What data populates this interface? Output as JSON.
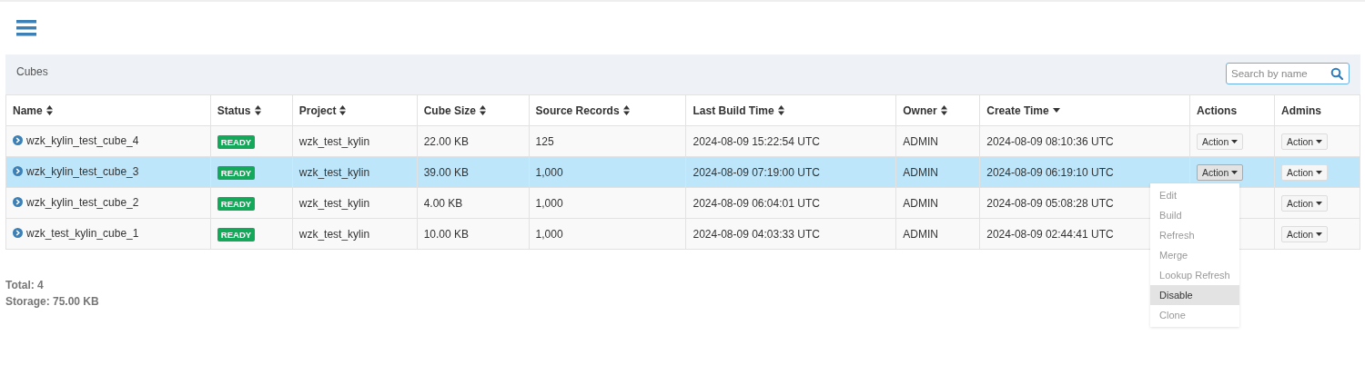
{
  "panel": {
    "title": "Cubes",
    "search": {
      "placeholder": "Search by name"
    }
  },
  "table": {
    "columns": [
      {
        "label": "Name",
        "sortable": true,
        "sorted": false
      },
      {
        "label": "Status",
        "sortable": true,
        "sorted": false
      },
      {
        "label": "Project",
        "sortable": true,
        "sorted": false
      },
      {
        "label": "Cube Size",
        "sortable": true,
        "sorted": false
      },
      {
        "label": "Source Records",
        "sortable": true,
        "sorted": false
      },
      {
        "label": "Last Build Time",
        "sortable": true,
        "sorted": false
      },
      {
        "label": "Owner",
        "sortable": true,
        "sorted": false
      },
      {
        "label": "Create Time",
        "sortable": true,
        "sorted": true
      },
      {
        "label": "Actions"
      },
      {
        "label": "Admins"
      }
    ],
    "rows": [
      {
        "selected": false,
        "menu_open": false,
        "name": "wzk_kylin_test_cube_4",
        "status": "READY",
        "project": "wzk_test_kylin",
        "size": "22.00 KB",
        "records": "125",
        "last_build": "2024-08-09 15:22:54 UTC",
        "owner": "ADMIN",
        "created": "2024-08-09 08:10:36 UTC",
        "action": "Action",
        "admin": "Action"
      },
      {
        "selected": true,
        "menu_open": true,
        "name": "wzk_kylin_test_cube_3",
        "status": "READY",
        "project": "wzk_test_kylin",
        "size": "39.00 KB",
        "records": "1,000",
        "last_build": "2024-08-09 07:19:00 UTC",
        "owner": "ADMIN",
        "created": "2024-08-09 06:19:10 UTC",
        "action": "Action",
        "admin": "Action"
      },
      {
        "selected": false,
        "menu_open": false,
        "name": "wzk_kylin_test_cube_2",
        "status": "READY",
        "project": "wzk_test_kylin",
        "size": "4.00 KB",
        "records": "1,000",
        "last_build": "2024-08-09 06:04:01 UTC",
        "owner": "ADMIN",
        "created": "2024-08-09 05:08:28 UTC",
        "admin": "Action"
      },
      {
        "selected": false,
        "menu_open": false,
        "name": "wzk_test_kylin_cube_1",
        "status": "READY",
        "project": "wzk_test_kylin",
        "size": "10.00 KB",
        "records": "1,000",
        "last_build": "2024-08-09 04:03:33 UTC",
        "owner": "ADMIN",
        "created": "2024-08-09 02:44:41 UTC",
        "admin": "Action"
      }
    ]
  },
  "action_menu": {
    "items": [
      {
        "label": "Edit",
        "disabled": true,
        "selected": false
      },
      {
        "label": "Build",
        "disabled": true,
        "selected": false
      },
      {
        "label": "Refresh",
        "disabled": true,
        "selected": false
      },
      {
        "label": "Merge",
        "disabled": true,
        "selected": false
      },
      {
        "label": "Lookup Refresh",
        "disabled": true,
        "selected": false
      },
      {
        "label": "Disable",
        "disabled": false,
        "selected": true
      },
      {
        "label": "Clone",
        "disabled": true,
        "selected": false
      }
    ]
  },
  "summary": {
    "total": "Total: 4",
    "storage": "Storage: 75.00 KB"
  }
}
